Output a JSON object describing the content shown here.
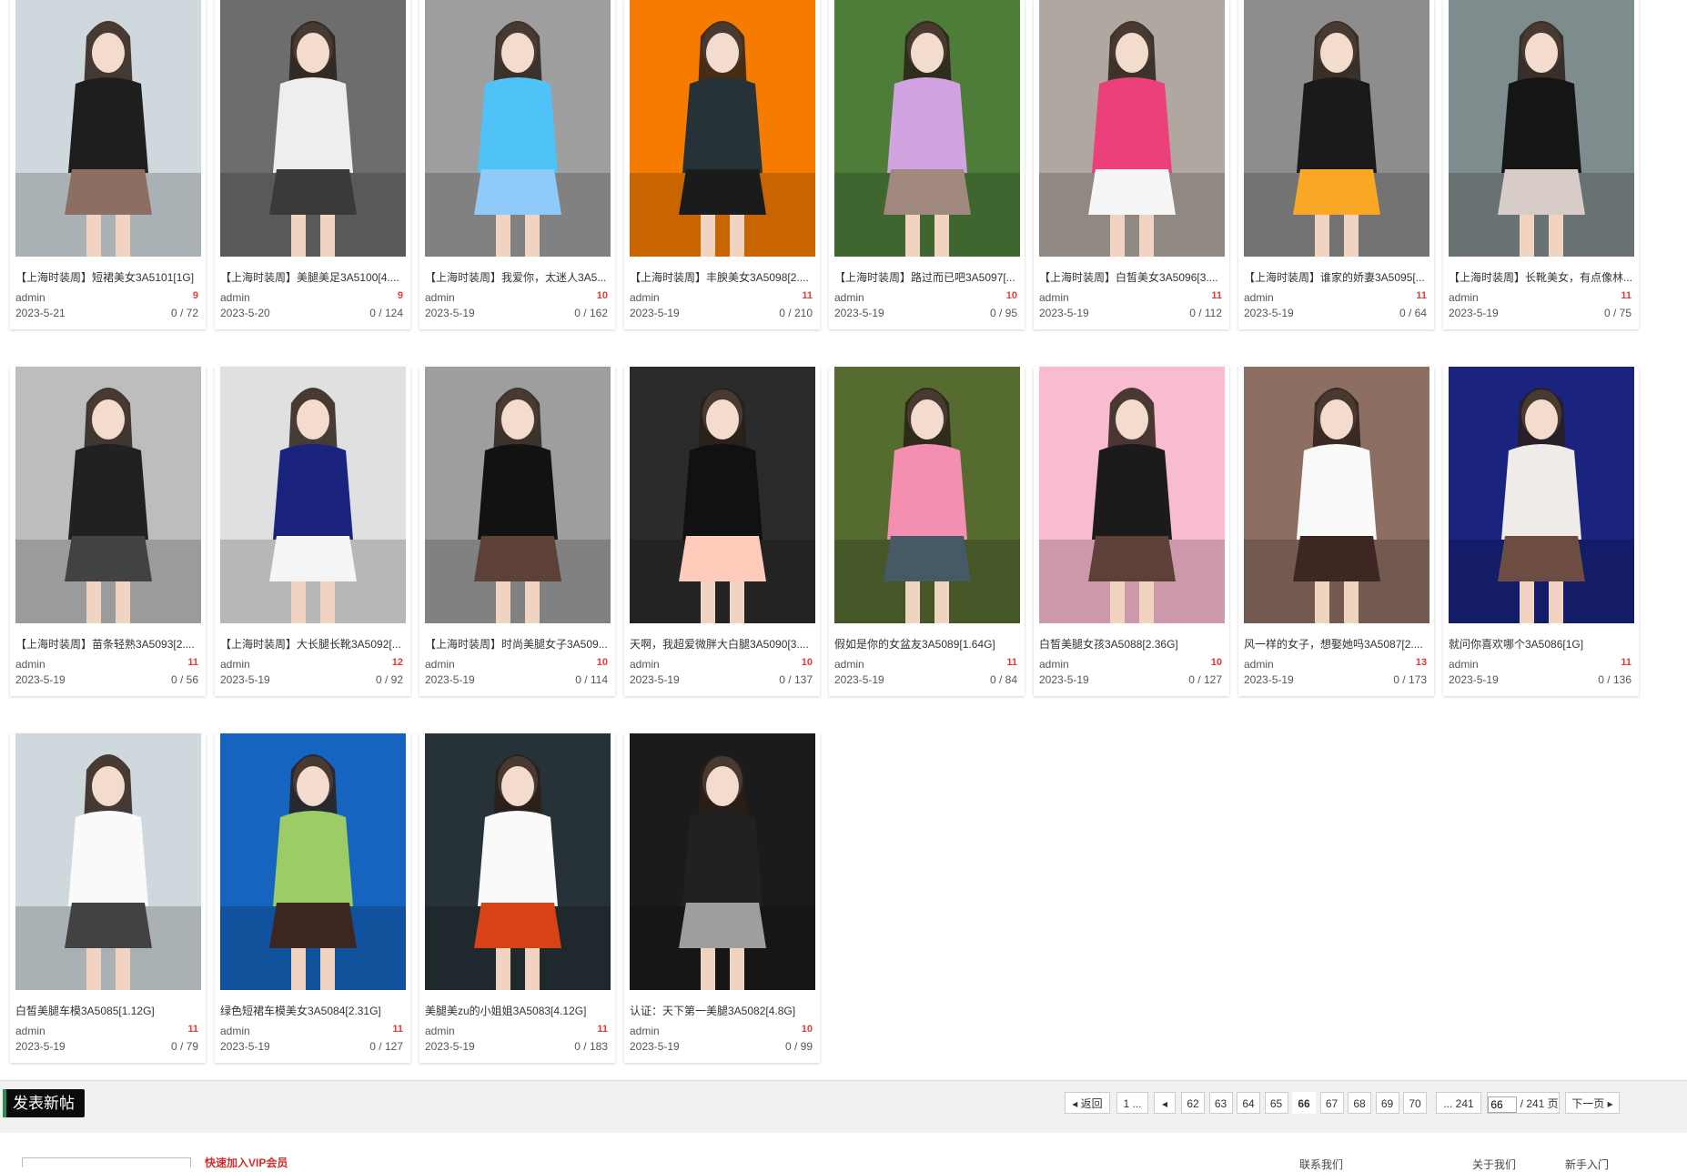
{
  "posts": [
    {
      "title": "【上海时装周】短裙美女3A5101[1G]",
      "author": "admin",
      "date": "2023-5-21",
      "badge": "9",
      "stats": "0 / 72",
      "palette": [
        "#cfd8dc",
        "#1e1e1e",
        "#8d6e63"
      ]
    },
    {
      "title": "【上海时装周】美腿美足3A5100[4....",
      "author": "admin",
      "date": "2023-5-20",
      "badge": "9",
      "stats": "0 / 124",
      "palette": [
        "#6d6d6d",
        "#eeeeee",
        "#3a3a3a"
      ]
    },
    {
      "title": "【上海时装周】我爱你，太迷人3A5...",
      "author": "admin",
      "date": "2023-5-19",
      "badge": "10",
      "stats": "0 / 162",
      "palette": [
        "#9e9e9e",
        "#4fc3f7",
        "#90caf9"
      ]
    },
    {
      "title": "【上海时装周】丰腴美女3A5098[2....",
      "author": "admin",
      "date": "2023-5-19",
      "badge": "11",
      "stats": "0 / 210",
      "palette": [
        "#f57c00",
        "#263238",
        "#1b1b1b"
      ]
    },
    {
      "title": "【上海时装周】路过而已吧3A5097[...",
      "author": "admin",
      "date": "2023-5-19",
      "badge": "10",
      "stats": "0 / 95",
      "palette": [
        "#4e7d3a",
        "#d1a3e0",
        "#a1887f"
      ]
    },
    {
      "title": "【上海时装周】白皙美女3A5096[3....",
      "author": "admin",
      "date": "2023-5-19",
      "badge": "11",
      "stats": "0 / 112",
      "palette": [
        "#b0a8a0",
        "#ec407a",
        "#f5f5f5"
      ]
    },
    {
      "title": "【上海时装周】谁家的娇妻3A5095[...",
      "author": "admin",
      "date": "2023-5-19",
      "badge": "11",
      "stats": "0 / 64",
      "palette": [
        "#8d8d8d",
        "#1a1a1a",
        "#f9a825"
      ]
    },
    {
      "title": "【上海时装周】长靴美女，有点像林...",
      "author": "admin",
      "date": "2023-5-19",
      "badge": "11",
      "stats": "0 / 75",
      "palette": [
        "#7f8c8d",
        "#151515",
        "#d7ccc8"
      ]
    },
    {
      "title": "【上海时装周】苗条轻熟3A5093[2....",
      "author": "admin",
      "date": "2023-5-19",
      "badge": "11",
      "stats": "0 / 56",
      "palette": [
        "#bdbdbd",
        "#212121",
        "#424242"
      ]
    },
    {
      "title": "【上海时装周】大长腿长靴3A5092[...",
      "author": "admin",
      "date": "2023-5-19",
      "badge": "12",
      "stats": "0 / 92",
      "palette": [
        "#e0e0e0",
        "#1a237e",
        "#f5f5f5"
      ]
    },
    {
      "title": "【上海时装周】时尚美腿女子3A509...",
      "author": "admin",
      "date": "2023-5-19",
      "badge": "10",
      "stats": "0 / 114",
      "palette": [
        "#9e9e9e",
        "#121212",
        "#5d4037"
      ]
    },
    {
      "title": "天啊，我超爱微胖大白腿3A5090[3....",
      "author": "admin",
      "date": "2023-5-19",
      "badge": "10",
      "stats": "0 / 137",
      "palette": [
        "#2b2b2b",
        "#111111",
        "#ffccbc"
      ]
    },
    {
      "title": "假如是你的女盆友3A5089[1.64G]",
      "author": "admin",
      "date": "2023-5-19",
      "badge": "11",
      "stats": "0 / 84",
      "palette": [
        "#556b2f",
        "#f48fb1",
        "#455a64"
      ]
    },
    {
      "title": "白皙美腿女孩3A5088[2.36G]",
      "author": "admin",
      "date": "2023-5-19",
      "badge": "10",
      "stats": "0 / 127",
      "palette": [
        "#f8bbd0",
        "#1b1b1b",
        "#5d4037"
      ]
    },
    {
      "title": "风一样的女子，想娶她吗3A5087[2....",
      "author": "admin",
      "date": "2023-5-19",
      "badge": "13",
      "stats": "0 / 173",
      "palette": [
        "#8d6e63",
        "#fafafa",
        "#3e2723"
      ]
    },
    {
      "title": "就问你喜欢哪个3A5086[1G]",
      "author": "admin",
      "date": "2023-5-19",
      "badge": "11",
      "stats": "0 / 136",
      "palette": [
        "#1a237e",
        "#efebe9",
        "#6d4c41"
      ]
    },
    {
      "title": "白皙美腿车模3A5085[1.12G]",
      "author": "admin",
      "date": "2023-5-19",
      "badge": "11",
      "stats": "0 / 79",
      "palette": [
        "#cfd8dc",
        "#fafafa",
        "#424242"
      ]
    },
    {
      "title": "绿色短裙车模美女3A5084[2.31G]",
      "author": "admin",
      "date": "2023-5-19",
      "badge": "11",
      "stats": "0 / 127",
      "palette": [
        "#1565c0",
        "#9ccc65",
        "#3e2723"
      ]
    },
    {
      "title": "美腿美zu的小姐姐3A5083[4.12G]",
      "author": "admin",
      "date": "2023-5-19",
      "badge": "11",
      "stats": "0 / 183",
      "palette": [
        "#263238",
        "#fafafa",
        "#d84315"
      ]
    },
    {
      "title": "认证：天下第一美腿3A5082[4.8G]",
      "author": "admin",
      "date": "2023-5-19",
      "badge": "10",
      "stats": "0 / 99",
      "palette": [
        "#1b1b1b",
        "#212121",
        "#9e9e9e"
      ]
    }
  ],
  "toolbar": {
    "new_post": "发表新帖"
  },
  "pagination": {
    "back": "返回",
    "first": "1 ...",
    "pages": [
      "62",
      "63",
      "64",
      "65",
      "66",
      "67",
      "68",
      "69",
      "70"
    ],
    "current": "66",
    "last": "... 241",
    "jump_value": "66",
    "total": "/ 241 页",
    "next": "下一页"
  },
  "footer": {
    "notice": "快速加入VIP会员",
    "links": [
      "联系我们",
      "关于我们",
      "新手入门"
    ]
  }
}
